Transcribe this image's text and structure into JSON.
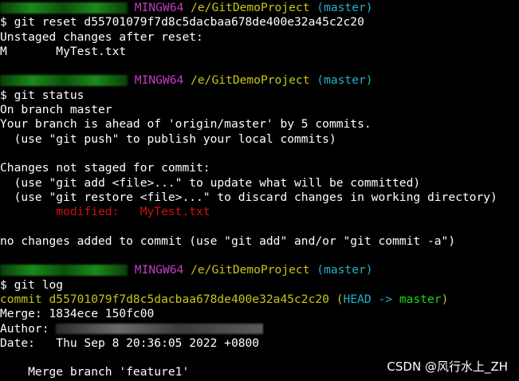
{
  "prompt": {
    "shell": "MINGW64",
    "path": "/e/GitDemoProject",
    "branch": "(master)"
  },
  "block1": {
    "command": "$ git reset d55701079f7d8c5dacbaa678de400e32a45c2c20",
    "line1": "Unstaged changes after reset:",
    "line2": "M       MyTest.txt"
  },
  "block2": {
    "command": "$ git status",
    "lines": [
      "On branch master",
      "Your branch is ahead of 'origin/master' by 5 commits.",
      "  (use \"git push\" to publish your local commits)",
      "",
      "Changes not staged for commit:",
      "  (use \"git add <file>...\" to update what will be committed)",
      "  (use \"git restore <file>...\" to discard changes in working directory)"
    ],
    "modified_label": "        modified:   ",
    "modified_file": "MyTest.txt",
    "final": "no changes added to commit (use \"git add\" and/or \"git commit -a\")"
  },
  "block3": {
    "command": "$ git log",
    "commit_label": "commit d55701079f7d8c5dacbaa678de400e32a45c2c20 ",
    "head_open": "(",
    "head": "HEAD -> ",
    "branch": "master",
    "head_close": ")",
    "merge": "Merge: 1834ece 150fc00",
    "author_label": "Author: ",
    "date": "Date:   Thu Sep 8 20:36:05 2022 +0800",
    "message": "    Merge branch 'feature1'"
  },
  "watermark": "CSDN @风行水上_ZH",
  "colors": {
    "background": "#000000",
    "user_host": "#1fd41f",
    "shell": "#c43cc4",
    "path": "#c5c51b",
    "branch": "#20b2c8",
    "modified": "#d01010"
  }
}
